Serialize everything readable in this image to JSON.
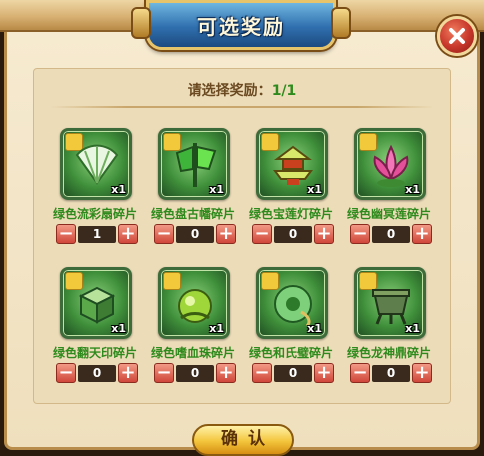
{
  "title": "可选奖励",
  "prompt": {
    "label": "请选择奖励：",
    "count": "1/1"
  },
  "rewards": [
    {
      "name": "绿色流彩扇碎片",
      "qty": "x1",
      "value": "1",
      "icon": "fan-icon"
    },
    {
      "name": "绿色盘古幡碎片",
      "qty": "x1",
      "value": "0",
      "icon": "banner-icon"
    },
    {
      "name": "绿色宝莲灯碎片",
      "qty": "x1",
      "value": "0",
      "icon": "pagoda-icon"
    },
    {
      "name": "绿色幽冥莲碎片",
      "qty": "x1",
      "value": "0",
      "icon": "lotus-icon"
    },
    {
      "name": "绿色翻天印碎片",
      "qty": "x1",
      "value": "0",
      "icon": "seal-icon"
    },
    {
      "name": "绿色嗜血珠碎片",
      "qty": "x1",
      "value": "0",
      "icon": "orb-icon"
    },
    {
      "name": "绿色和氏璧碎片",
      "qty": "x1",
      "value": "0",
      "icon": "jade-icon"
    },
    {
      "name": "绿色龙神鼎碎片",
      "qty": "x1",
      "value": "0",
      "icon": "cauldron-icon"
    }
  ],
  "stepper": {
    "minus": "−",
    "plus": "+"
  },
  "confirm_label": "确认"
}
